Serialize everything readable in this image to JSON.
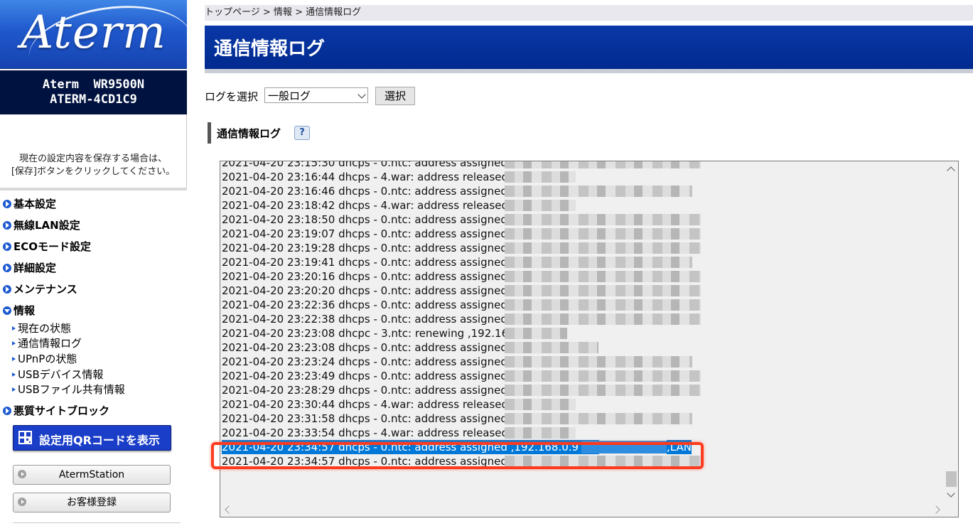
{
  "brand": {
    "logo_text": "Aterm"
  },
  "device": {
    "model": "Aterm  WR9500N",
    "name": "ATERM-4CD1C9"
  },
  "save_note": {
    "line1": "現在の設定内容を保存する場合は、",
    "line2": "[保存]ボタンをクリックしてください。"
  },
  "nav": {
    "basic": "基本設定",
    "wireless": "無線LAN設定",
    "eco": "ECOモード設定",
    "detail": "詳細設定",
    "maintenance": "メンテナンス",
    "info": "情報",
    "info_sub": [
      "現在の状態",
      "通信情報ログ",
      "UPnPの状態",
      "USBデバイス情報",
      "USBファイル共有情報"
    ],
    "malicious": "悪質サイトブロック"
  },
  "buttons": {
    "qr": "設定用QRコードを表示",
    "station": "AtermStation",
    "register": "お客様登録",
    "select": "選択"
  },
  "breadcrumb": {
    "home": "トップページ",
    "sep": " > ",
    "info": "情報",
    "current": "通信情報ログ"
  },
  "page": {
    "title": "通信情報ログ",
    "section_title": "通信情報ログ",
    "help": "?"
  },
  "log_select": {
    "label": "ログを選択",
    "value": "一般ログ"
  },
  "log": {
    "lines": [
      "2021-04-20 23:15:30 dhcps - 0.ntc: address assigned",
      "2021-04-20 23:16:44 dhcps - 4.war: address released",
      "2021-04-20 23:16:46 dhcps - 0.ntc: address assigned",
      "2021-04-20 23:18:42 dhcps - 4.war: address released",
      "2021-04-20 23:18:50 dhcps - 0.ntc: address assigned",
      "2021-04-20 23:19:07 dhcps - 0.ntc: address assigned",
      "2021-04-20 23:19:28 dhcps - 0.ntc: address assigned",
      "2021-04-20 23:19:41 dhcps - 0.ntc: address assigned",
      "2021-04-20 23:20:16 dhcps - 0.ntc: address assigned",
      "2021-04-20 23:20:20 dhcps - 0.ntc: address assigned",
      "2021-04-20 23:22:36 dhcps - 0.ntc: address assigned",
      "2021-04-20 23:22:38 dhcps - 0.ntc: address assigned",
      "2021-04-20 23:23:08 dhcpc - 3.ntc: renewing ,192.168",
      "2021-04-20 23:23:08 dhcps - 0.ntc: address assigned",
      "2021-04-20 23:23:24 dhcps - 0.ntc: address assigned",
      "2021-04-20 23:23:49 dhcps - 0.ntc: address assigned",
      "2021-04-20 23:28:29 dhcps - 0.ntc: address assigned",
      "2021-04-20 23:30:44 dhcps - 4.war: address released",
      "2021-04-20 23:31:58 dhcps - 0.ntc: address assigned",
      "2021-04-20 23:33:54 dhcps - 4.war: address released"
    ],
    "selected_line": "2021-04-20 23:34:57 dhcps - 0.ntc: address assigned ,192.168.0.9 ,f0:",
    "selected_tail": ",LAN",
    "last_line": "2021-04-20 23:34:57 dhcps - 0.ntc: address assigned"
  },
  "colors": {
    "nav_blue": "#1e5bd0",
    "title_bar": "#002a8e",
    "highlight": "#ff3b1f",
    "selection": "#0078d7"
  }
}
